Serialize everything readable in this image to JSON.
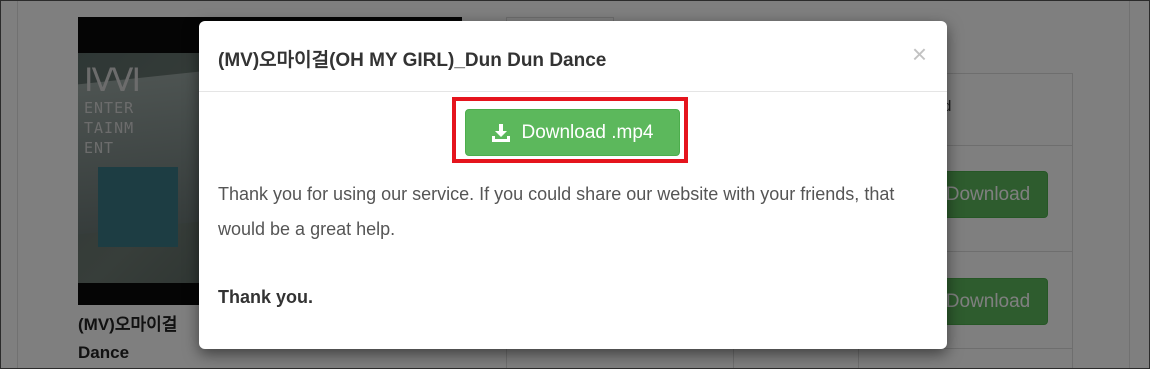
{
  "background": {
    "logo_lines": [
      "ENTER",
      "TAINM",
      "ENT"
    ],
    "video_title": "(MV)오마이걸 Dance",
    "row_buttons": [
      "Download",
      "Download"
    ],
    "header_fragment": "d"
  },
  "modal": {
    "title": "(MV)오마이걸(OH MY GIRL)_Dun Dun Dance",
    "close_label": "×",
    "download_label": "Download .mp4",
    "message": "Thank you for using our service. If you could share our website with your friends, that would be a great help.",
    "thanks": "Thank you."
  },
  "colors": {
    "button_green": "#5cb85c",
    "highlight_red": "#e5141d",
    "backdrop": "rgba(0,0,0,0.5)"
  },
  "icons": {
    "download": "download-icon",
    "close": "close-icon"
  }
}
